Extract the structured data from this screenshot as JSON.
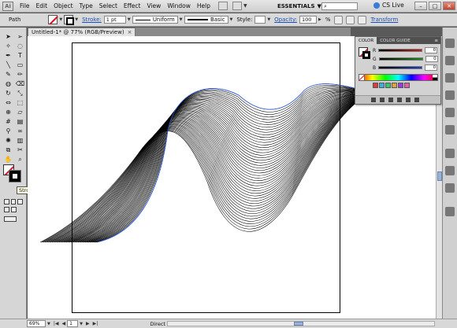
{
  "menubar": {
    "logo": "Ai",
    "items": [
      "File",
      "Edit",
      "Object",
      "Type",
      "Select",
      "Effect",
      "View",
      "Window",
      "Help"
    ],
    "workspace": "ESSENTIALS",
    "cs_live": "CS Live"
  },
  "controlbar": {
    "selection_type": "Path",
    "stroke_label": "Stroke:",
    "stroke_weight": "1 pt",
    "variable_width": "Uniform",
    "brush": "Basic",
    "style_label": "Style:",
    "opacity_label": "Opacity:",
    "opacity_value": "100",
    "opacity_unit": "%",
    "transform_label": "Transform"
  },
  "document": {
    "tab_title": "Untitled-1* @ 77% (RGB/Preview)",
    "tab_close": "×"
  },
  "toolbox": {
    "tools": [
      "selection",
      "direct-selection",
      "magic-wand",
      "lasso",
      "pen",
      "type",
      "line",
      "rectangle",
      "paintbrush",
      "pencil",
      "blob-brush",
      "eraser",
      "rotate",
      "scale",
      "width",
      "free-transform",
      "shape-builder",
      "perspective",
      "mesh",
      "gradient",
      "eyedropper",
      "blend",
      "symbol-sprayer",
      "column-graph",
      "artboard",
      "slice",
      "hand",
      "zoom"
    ],
    "tooltip": "Stroke (X)"
  },
  "color_panel": {
    "tabs": [
      "COLOR",
      "COLOR GUIDE"
    ],
    "channels": [
      {
        "label": "R",
        "value": "0",
        "color": "#c41e1e"
      },
      {
        "label": "G",
        "value": "0",
        "color": "#1e8a1e"
      },
      {
        "label": "B",
        "value": "0",
        "color": "#1e3ec4"
      }
    ],
    "kuler_swatches": [
      "#e03a3a",
      "#3ab0e0",
      "#38c46a",
      "#e0a23a",
      "#9a3ae0",
      "#e05fa8"
    ]
  },
  "statusbar": {
    "zoom": "69%",
    "page": "1",
    "status": "Direct Selection"
  },
  "art": {
    "line_count": 48,
    "stroke_color": "#000000",
    "selection_color": "#2b5ce6"
  }
}
